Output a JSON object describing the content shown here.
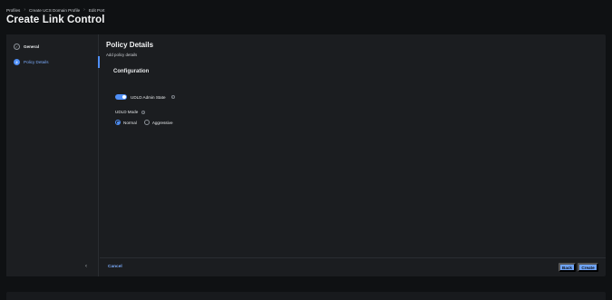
{
  "breadcrumb": {
    "items": [
      "Profiles",
      "Create UCS Domain Profile",
      "Edit Port"
    ],
    "separator": "›"
  },
  "page": {
    "title": "Create Link Control"
  },
  "steps": [
    {
      "label": "General",
      "status": "done",
      "icon": "check-icon",
      "marker": "✓"
    },
    {
      "label": "Policy Details",
      "status": "active",
      "icon": "step-number",
      "marker": "2"
    }
  ],
  "nav": {
    "collapse_glyph": "‹"
  },
  "content": {
    "title": "Policy Details",
    "subtitle": "Add policy details",
    "configuration_title": "Configuration",
    "udld_admin_state": {
      "label": "UDLD Admin State",
      "enabled": true
    },
    "udld_mode": {
      "label": "UDLD Mode",
      "options": [
        "Normal",
        "Aggressive"
      ],
      "selected": "Normal"
    },
    "info_glyph": "i"
  },
  "footer": {
    "cancel_label": "Cancel",
    "back_label": "Back",
    "create_label": "Create"
  },
  "colors": {
    "accent": "#4f8ff7",
    "button": "#6ea3f8",
    "background": "#0f1113",
    "panel": "#1b1d20"
  }
}
